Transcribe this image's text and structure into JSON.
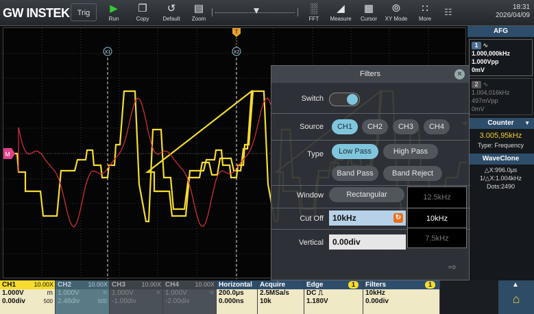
{
  "topbar": {
    "logo": "GW INSTEK",
    "trig_label": "Trig",
    "buttons": [
      {
        "label": "Run",
        "icon": "play-icon"
      },
      {
        "label": "Copy",
        "icon": "copy-icon"
      },
      {
        "label": "Default",
        "icon": "default-icon"
      },
      {
        "label": "Zoom",
        "icon": "zoom-icon"
      }
    ],
    "right_buttons": [
      {
        "label": "FFT",
        "icon": "fft-icon"
      },
      {
        "label": "Measure",
        "icon": "measure-icon"
      },
      {
        "label": "Cursor",
        "icon": "cursor-icon"
      },
      {
        "label": "XY Mode",
        "icon": "xy-mode-icon"
      },
      {
        "label": "More",
        "icon": "more-icon"
      }
    ],
    "time": "18:31",
    "date": "2026/04/09"
  },
  "plot": {
    "markers": {
      "x1": "X1",
      "x2": "X2",
      "trigger": "T",
      "ground": "M"
    }
  },
  "right_panel": {
    "afg_title": "AFG",
    "afg1": {
      "num": "1",
      "freq": "1.000,000kHz",
      "amp": "1.000Vpp",
      "offset": "0mV"
    },
    "afg2": {
      "num": "2",
      "freq": "1.004,016kHz",
      "amp": "497mVpp",
      "offset": "0mV"
    },
    "counter_title": "Counter",
    "counter_value": "3.005,95kHz",
    "counter_type": "Type: Frequency",
    "waveclone_title": "WaveClone",
    "dx": "△X:996.0μs",
    "inv_dx": "1/△X:1.004kHz",
    "dots": "Dots:2490"
  },
  "filters": {
    "title": "Filters",
    "switch_label": "Switch",
    "switch_on": true,
    "source_label": "Source",
    "sources": [
      "CH1",
      "CH2",
      "CH3",
      "CH4"
    ],
    "source_selected": "CH1",
    "type_label": "Type",
    "types": [
      "Low Pass",
      "High Pass",
      "Band Pass",
      "Band Reject"
    ],
    "type_selected": "Low Pass",
    "window_label": "Window",
    "window_value": "Rectangular",
    "cutoff_label": "Cut Off",
    "cutoff_value": "10kHz",
    "vertical_label": "Vertical",
    "vertical_value": "0.00div",
    "dropdown": [
      "12.5kHz",
      "10kHz",
      "7.5kHz"
    ],
    "dropdown_selected": "10kHz"
  },
  "bottom": {
    "ch1": {
      "name": "CH1",
      "probe": "10.00X",
      "scale": "1.000V",
      "coupling": "m",
      "offset": "0.00div",
      "bw": "500"
    },
    "ch2": {
      "name": "CH2",
      "probe": "10.00X",
      "scale": "1.000V",
      "coupling": "=",
      "offset": "2.48div",
      "bw": "500"
    },
    "ch3": {
      "name": "CH3",
      "probe": "10.00X",
      "scale": "1.000V",
      "coupling": "=",
      "offset": "-1.00div"
    },
    "ch4": {
      "name": "CH4",
      "probe": "10.00X",
      "scale": "1.000V",
      "coupling": "=",
      "offset": "-2.00div"
    },
    "horizontal": {
      "title": "Horizontal",
      "scale": "200.0μs",
      "pos": "0.000ns"
    },
    "acquire": {
      "title": "Acquire",
      "rate": "2.5MSa/s",
      "len": "10k"
    },
    "edge": {
      "title": "Edge",
      "badge": "1",
      "coupling": "DC ⎍",
      "level": "1.180V"
    },
    "filters": {
      "title": "Filters",
      "badge": "1",
      "cutoff": "10kHz",
      "vertical": "0.00div"
    }
  },
  "colors": {
    "ch1": "#f5dc2e",
    "ch2": "#57c6e0",
    "ch3": "#ff5cc4",
    "ch4": "#4a90e2",
    "filter_trace": "#e0303a",
    "accent": "#7fc6dd"
  }
}
